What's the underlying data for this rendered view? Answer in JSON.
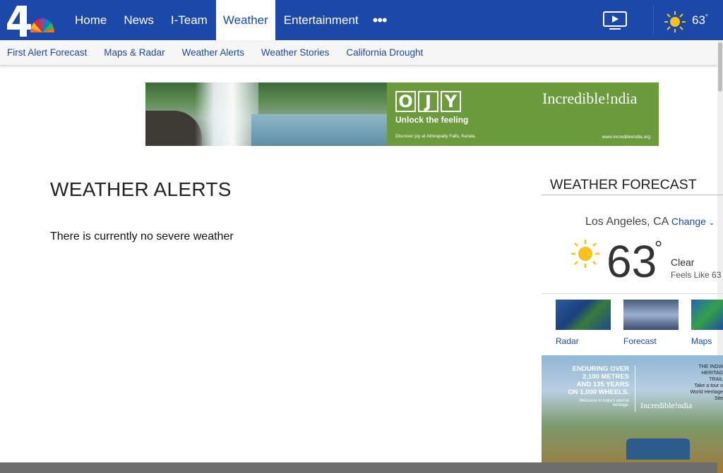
{
  "header": {
    "nav_items": [
      {
        "label": "Home"
      },
      {
        "label": "News"
      },
      {
        "label": "I-Team"
      },
      {
        "label": "Weather"
      },
      {
        "label": "Entertainment"
      }
    ],
    "more_label": "•••",
    "temp": "63",
    "temp_degree": "°",
    "icons": {
      "logo": "nbc4-logo",
      "video": "tv-play-icon",
      "weather": "sun-icon"
    }
  },
  "subnav": {
    "items": [
      {
        "label": "First Alert Forecast"
      },
      {
        "label": "Maps & Radar"
      },
      {
        "label": "Weather Alerts"
      },
      {
        "label": "Weather Stories"
      },
      {
        "label": "California Drought"
      }
    ]
  },
  "ad_banner": {
    "letters": [
      "O",
      "J",
      "Y"
    ],
    "tagline": "Unlock the feeling",
    "caption": "Discover joy at Athirapally Falls, Kerala.",
    "brand": "Incredible!ndia",
    "url": "www.incredibleindia.org"
  },
  "main": {
    "title": "WEATHER ALERTS",
    "message": "There is currently no severe weather"
  },
  "forecast": {
    "title": "WEATHER FORECAST",
    "location": "Los Angeles, CA",
    "change_label": "Change",
    "temp": "63",
    "degree": "°",
    "condition": "Clear",
    "feels_like": "Feels Like 63 °",
    "thumbs": [
      {
        "label": "Radar"
      },
      {
        "label": "Forecast"
      },
      {
        "label": "Maps"
      }
    ]
  },
  "side_ad": {
    "headline_1": "ENDURING OVER",
    "headline_2": "2,100 METRES",
    "headline_3": "AND 135 YEARS",
    "headline_4": "ON 1,000 WHEELS.",
    "welcome": "Welcome to India's eternal heritage.",
    "brand": "Incredible!ndia",
    "right_1": "THE INDIA",
    "right_2": "HERITAG",
    "right_3": "TRAIL",
    "right_4": "Take a tour o",
    "right_5": "World Heritage Site"
  },
  "colors": {
    "brand_blue": "#1c48a8",
    "ad_green": "#6b9b3c"
  }
}
